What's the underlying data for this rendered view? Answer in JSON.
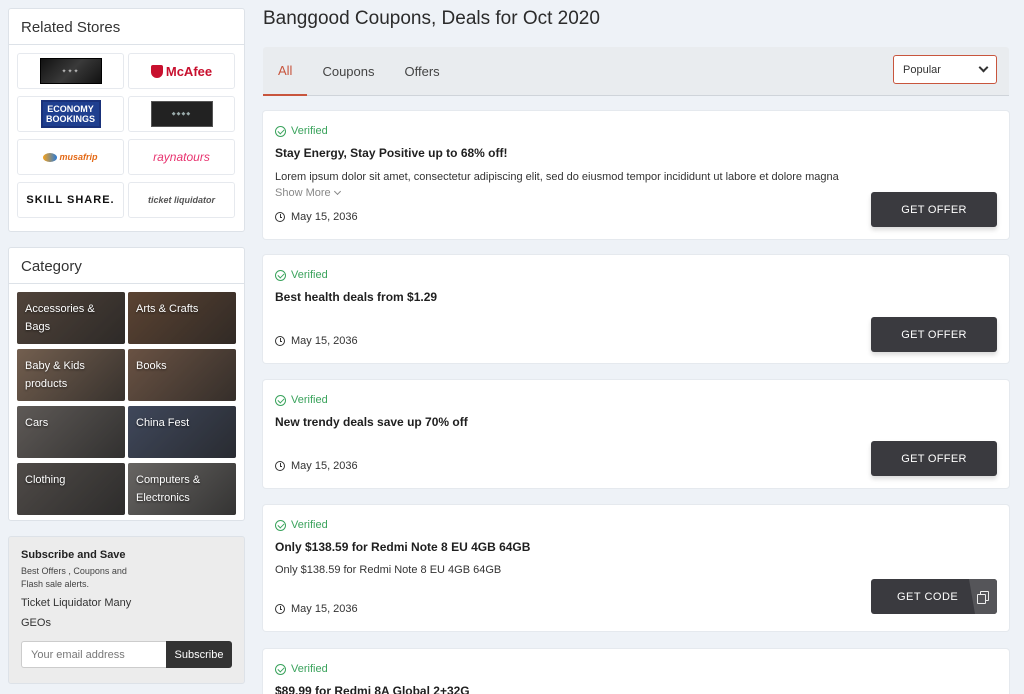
{
  "sidebar": {
    "related_stores": {
      "title": "Related Stores",
      "stores": [
        {
          "name": "",
          "logo": "dark-banner"
        },
        {
          "name": "McAfee",
          "logo": "mcafee"
        },
        {
          "name": "ECONOMY BOOKINGS",
          "logo": "economy-bookings"
        },
        {
          "name": "",
          "logo": "forest-village"
        },
        {
          "name": "musafrip",
          "logo": "musafrip"
        },
        {
          "name": "raynatours",
          "logo": "raynatours"
        },
        {
          "name": "SKILL SHARE.",
          "logo": "skillshare"
        },
        {
          "name": "ticket liquidator",
          "logo": "ticket-liquidator"
        }
      ]
    },
    "category": {
      "title": "Category",
      "items": [
        {
          "label": "Accessories & Bags",
          "color": "#6b5a4e"
        },
        {
          "label": "Arts & Crafts",
          "color": "#7a5a44"
        },
        {
          "label": "Baby & Kids products",
          "color": "#9a7f6a"
        },
        {
          "label": "Books",
          "color": "#8d6e5a"
        },
        {
          "label": "Cars",
          "color": "#7e7874"
        },
        {
          "label": "China Fest",
          "color": "#55607a"
        },
        {
          "label": "Clothing",
          "color": "#6a6460"
        },
        {
          "label": "Computers & Electronics",
          "color": "#8a8784"
        }
      ]
    },
    "subscribe": {
      "title": "Subscribe and Save",
      "small_text": "Best Offers , Coupons and Flash sale alerts.",
      "text": "Ticket Liquidator Many GEOs",
      "placeholder": "Your email address",
      "button": "Subscribe"
    }
  },
  "main": {
    "title": "Banggood Coupons, Deals for Oct 2020",
    "tabs": [
      {
        "label": "All",
        "active": true
      },
      {
        "label": "Coupons",
        "active": false
      },
      {
        "label": "Offers",
        "active": false
      }
    ],
    "sort": {
      "selected": "Popular"
    },
    "offers": [
      {
        "verified": "Verified",
        "title": "Stay Energy, Stay Positive up to 68% off!",
        "description": "Lorem ipsum dolor sit amet, consectetur adipiscing elit, sed do eiusmod tempor incididunt ut labore et dolore magna",
        "show_more": "Show More",
        "date": "May 15, 2036",
        "button": "GET OFFER"
      },
      {
        "verified": "Verified",
        "title": "Best health deals from $1.29",
        "date": "May 15, 2036",
        "button": "GET OFFER"
      },
      {
        "verified": "Verified",
        "title": "New trendy deals save up 70% off",
        "date": "May 15, 2036",
        "button": "GET OFFER"
      },
      {
        "verified": "Verified",
        "title": "Only $138.59 for Redmi Note 8 EU 4GB 64GB",
        "description": "Only $138.59 for Redmi Note 8 EU 4GB 64GB",
        "date": "May 15, 2036",
        "button": "GET CODE"
      },
      {
        "verified": "Verified",
        "title": "$89.99 for Redmi 8A Global 2+32G"
      }
    ]
  },
  "colors": {
    "accent": "#c8553d",
    "verified": "#3aa35c",
    "button": "#3a3a3f"
  }
}
